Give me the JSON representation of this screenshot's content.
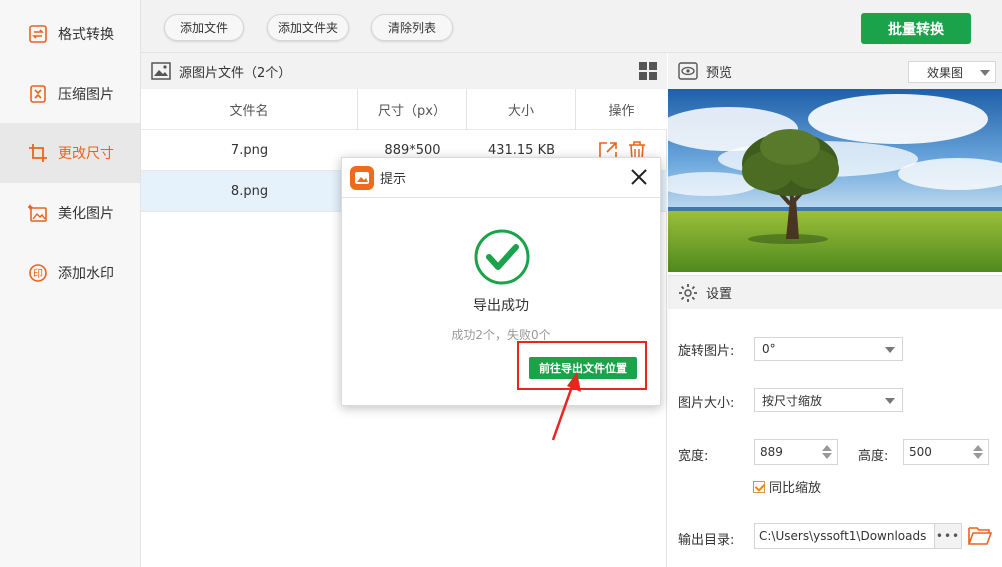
{
  "sidebar": {
    "items": [
      {
        "label": "格式转换",
        "icon": "format-convert-icon",
        "active": false
      },
      {
        "label": "压缩图片",
        "icon": "compress-icon",
        "active": false
      },
      {
        "label": "更改尺寸",
        "icon": "resize-icon",
        "active": true
      },
      {
        "label": "美化图片",
        "icon": "beautify-icon",
        "active": false
      },
      {
        "label": "添加水印",
        "icon": "watermark-icon",
        "active": false
      }
    ]
  },
  "toolbar": {
    "add_file": "添加文件",
    "add_folder": "添加文件夹",
    "clear_list": "清除列表",
    "batch_convert": "批量转换"
  },
  "file_panel": {
    "title": "源图片文件（2个）",
    "columns": [
      "文件名",
      "尺寸（px）",
      "大小",
      "操作"
    ],
    "rows": [
      {
        "name": "7.png",
        "size": "889*500",
        "filesize": "431.15 KB"
      },
      {
        "name": "8.png",
        "size": "",
        "filesize": ""
      }
    ]
  },
  "preview": {
    "title": "预览",
    "mode": "效果图"
  },
  "settings": {
    "title": "设置",
    "rotate_label": "旋转图片:",
    "rotate_value": "0°",
    "size_label": "图片大小:",
    "size_value": "按尺寸缩放",
    "width_label": "宽度:",
    "width_value": "889",
    "height_label": "高度:",
    "height_value": "500",
    "keep_ratio_label": "同比缩放",
    "keep_ratio_checked": true,
    "output_label": "输出目录:",
    "output_path": "C:\\Users\\yssoft1\\Downloads",
    "more": "•••"
  },
  "dialog": {
    "title": "提示",
    "message": "导出成功",
    "sub": "成功2个，失败0个",
    "goto_button": "前往导出文件位置"
  },
  "colors": {
    "accent": "#e8641e",
    "green": "#1aa34a",
    "highlight_red": "#e8261f"
  }
}
